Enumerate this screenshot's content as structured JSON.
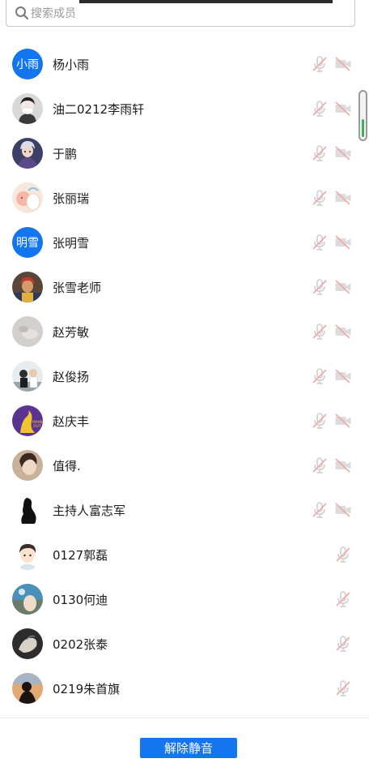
{
  "search": {
    "placeholder": "搜索成员"
  },
  "members": [
    {
      "name": "杨小雨",
      "avatar": "text",
      "avatar_text": "小雨",
      "camera_icon": true
    },
    {
      "name": "油二0212李雨轩",
      "avatar": "photo",
      "photo": "masked-person",
      "camera_icon": true
    },
    {
      "name": "于鹏",
      "avatar": "photo",
      "photo": "anime-character",
      "camera_icon": true
    },
    {
      "name": "张丽瑞",
      "avatar": "photo",
      "photo": "cartoon-pink",
      "camera_icon": true
    },
    {
      "name": "张明雪",
      "avatar": "text",
      "avatar_text": "明雪",
      "camera_icon": true
    },
    {
      "name": "张雪老师",
      "avatar": "photo",
      "photo": "colorful-character",
      "camera_icon": true
    },
    {
      "name": "赵芳敏",
      "avatar": "photo",
      "photo": "light-gray",
      "camera_icon": true
    },
    {
      "name": "赵俊扬",
      "avatar": "photo",
      "photo": "people-outdoor",
      "camera_icon": true
    },
    {
      "name": "赵庆丰",
      "avatar": "photo",
      "photo": "mamba-purple",
      "camera_icon": true
    },
    {
      "name": "值得.",
      "avatar": "photo",
      "photo": "portrait-warm",
      "camera_icon": true
    },
    {
      "name": "主持人富志军",
      "avatar": "photo",
      "photo": "black-silhouette",
      "camera_icon": true
    },
    {
      "name": "0127郭磊",
      "avatar": "photo",
      "photo": "cartoon-boy",
      "camera_icon": false
    },
    {
      "name": "0130何迪",
      "avatar": "photo",
      "photo": "landscape-blue",
      "camera_icon": false
    },
    {
      "name": "0202张泰",
      "avatar": "photo",
      "photo": "dark-bird",
      "camera_icon": false
    },
    {
      "name": "0219朱首旗",
      "avatar": "photo",
      "photo": "sunset-silhouette",
      "camera_icon": false
    }
  ],
  "footer": {
    "unmute_label": "解除静音"
  },
  "colors": {
    "accent": "#1476ef",
    "scroll_thumb": "#3cae62",
    "muted_icon_gray": "#cfcfcf",
    "muted_slash_red": "#f2a6a6"
  }
}
